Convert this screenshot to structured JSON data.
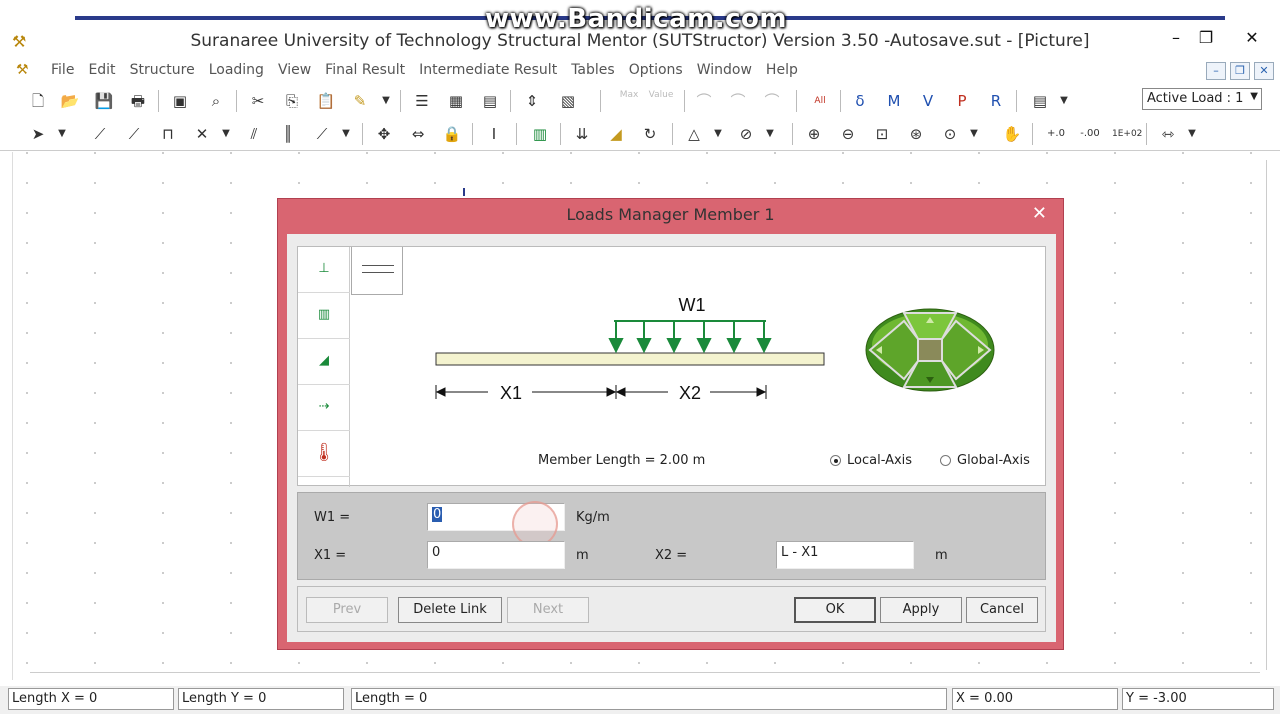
{
  "watermark": "www.Bandicam.com",
  "window": {
    "title": "Suranaree University of Technology Structural Mentor (SUTStructor) Version 3.50 -Autosave.sut - [Picture]",
    "minimize": "–",
    "maximize": "❐",
    "close": "✕"
  },
  "menu": {
    "items": [
      "File",
      "Edit",
      "Structure",
      "Loading",
      "View",
      "Final Result",
      "Intermediate Result",
      "Tables",
      "Options",
      "Window",
      "Help"
    ]
  },
  "toolbar": {
    "max_label": "Max",
    "value_label": "Value",
    "all_label": "All",
    "active_load": "Active Load : 1"
  },
  "dialog": {
    "title": "Loads Manager  Member 1",
    "close": "✕",
    "diagram": {
      "load_label": "W1",
      "x1_label": "X1",
      "x2_label": "X2"
    },
    "member_length": "Member Length = 2.00 m",
    "local_axis": "Local-Axis",
    "global_axis": "Global-Axis",
    "fields": {
      "w1_label": "W1 =",
      "w1_value": "0",
      "w1_unit": "Kg/m",
      "x1_label": "X1 =",
      "x1_value": "0",
      "x1_unit": "m",
      "x2_label": "X2 =",
      "x2_value": "L - X1",
      "x2_unit": "m"
    },
    "buttons": {
      "prev": "Prev",
      "delete_link": "Delete Link",
      "next": "Next",
      "ok": "OK",
      "apply": "Apply",
      "cancel": "Cancel"
    }
  },
  "status": {
    "length_x": "Length X = 0",
    "length_y": "Length Y = 0",
    "length": "Length = 0",
    "x": "X = 0.00",
    "y": "Y = -3.00"
  }
}
